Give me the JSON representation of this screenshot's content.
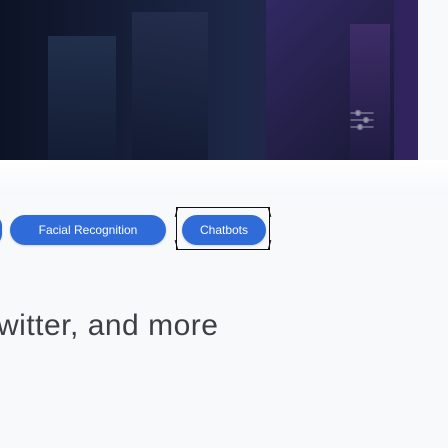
{
  "hero": {
    "image_name": "dark abstract banner"
  },
  "toolbar": {
    "icon": "sliders-icon"
  },
  "tags": [
    {
      "label": ""
    },
    {
      "label": "Facial Recognition"
    },
    {
      "label": "Chatbots"
    }
  ],
  "main": {
    "headline": "witter, and more"
  },
  "colors": {
    "tag_blue": "#2f6bd9",
    "hero_dark": "#1d2747",
    "headline_text": "#3d3f44",
    "background": "#f8f9fb"
  }
}
